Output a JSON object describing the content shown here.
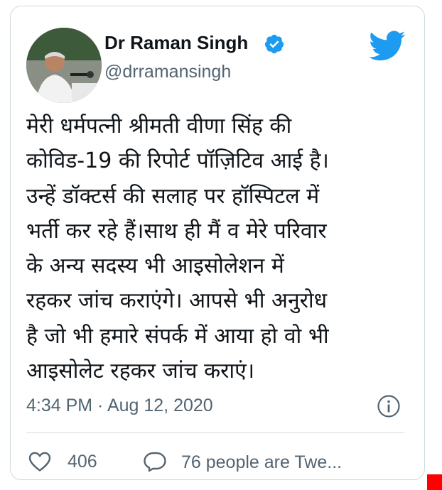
{
  "author": {
    "display_name": "Dr Raman Singh",
    "handle": "@drramansingh",
    "verified": true,
    "avatar_icon": "profile-photo"
  },
  "tweet": {
    "lines": [
      "मेरी धर्मपत्नी श्रीमती वीणा सिंह की",
      "कोविड-19 की रिपोर्ट पॉज़िटिव आई है।",
      "उन्हें डॉक्टर्स की सलाह पर हॉस्पिटल में",
      "भर्ती कर रहे हैं।साथ ही मैं व मेरे परिवार",
      "के अन्य सदस्य भी आइसोलेशन में",
      "रहकर जांच कराएंगे। आपसे भी अनुरोध",
      "है जो भी हमारे संपर्क में आया हो वो भी",
      "आइसोलेट रहकर जांच कराएं।"
    ],
    "timestamp": "4:34 PM · Aug 12, 2020"
  },
  "actions": {
    "likes": "406",
    "replies_text": "76 people are Twe..."
  },
  "icons": {
    "brand": "twitter-bird-icon",
    "info": "info-icon",
    "like": "heart-icon",
    "reply": "speech-bubble-icon",
    "verified": "verified-badge-icon"
  },
  "colors": {
    "twitter_blue": "#1d9bf0",
    "text_primary": "#0f1419",
    "text_secondary": "#536471",
    "border": "#cfd9de",
    "corner_mark": "#ff0000"
  }
}
